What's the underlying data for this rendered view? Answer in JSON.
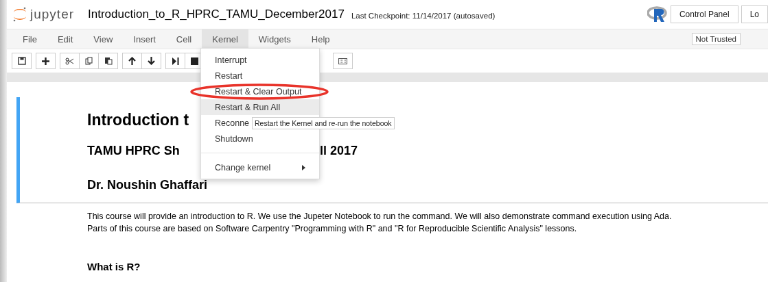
{
  "header": {
    "logo_text": "jupyter",
    "title": "Introduction_to_R_HPRC_TAMU_December2017",
    "checkpoint": "Last Checkpoint: 11/14/2017 (autosaved)",
    "buttons": [
      "Control Panel",
      "Lo"
    ]
  },
  "menubar": {
    "items": [
      {
        "label": "File",
        "selected": false
      },
      {
        "label": "Edit",
        "selected": false
      },
      {
        "label": "View",
        "selected": false
      },
      {
        "label": "Insert",
        "selected": false
      },
      {
        "label": "Cell",
        "selected": false
      },
      {
        "label": "Kernel",
        "selected": true
      },
      {
        "label": "Widgets",
        "selected": false
      },
      {
        "label": "Help",
        "selected": false
      }
    ],
    "trust": "Not Trusted"
  },
  "kernel_menu": {
    "items": [
      {
        "kind": "item",
        "label": "Interrupt",
        "highlighted": false
      },
      {
        "kind": "item",
        "label": "Restart",
        "highlighted": false
      },
      {
        "kind": "item",
        "label": "Restart & Clear Output",
        "highlighted": false,
        "circled": true
      },
      {
        "kind": "item",
        "label": "Restart & Run All",
        "highlighted": true
      },
      {
        "kind": "item",
        "label": "Reconne",
        "highlighted": false
      },
      {
        "kind": "item",
        "label": "Shutdown",
        "highlighted": false
      },
      {
        "kind": "divider"
      },
      {
        "kind": "submenu",
        "label": "Change kernel",
        "highlighted": false
      }
    ],
    "tooltip": "Restart the Kernel and re-run the notebook"
  },
  "notebook": {
    "heading_cell": {
      "h1": "Introduction t",
      "h2": [
        "TAMU HPRC Sh",
        "ll 2017"
      ],
      "h3": "Dr. Noushin Ghaffari"
    },
    "paragraph": [
      "This course will provide an introduction to R. We use the Jupeter Notebook to run the command. We will also demonstrate command execution using Ada.",
      "Parts of this course are based on Software Carpentry \"Programming with R\" and \"R for Reproducible Scientific Analysis\" lessons."
    ],
    "section_heading": "What is R?"
  }
}
